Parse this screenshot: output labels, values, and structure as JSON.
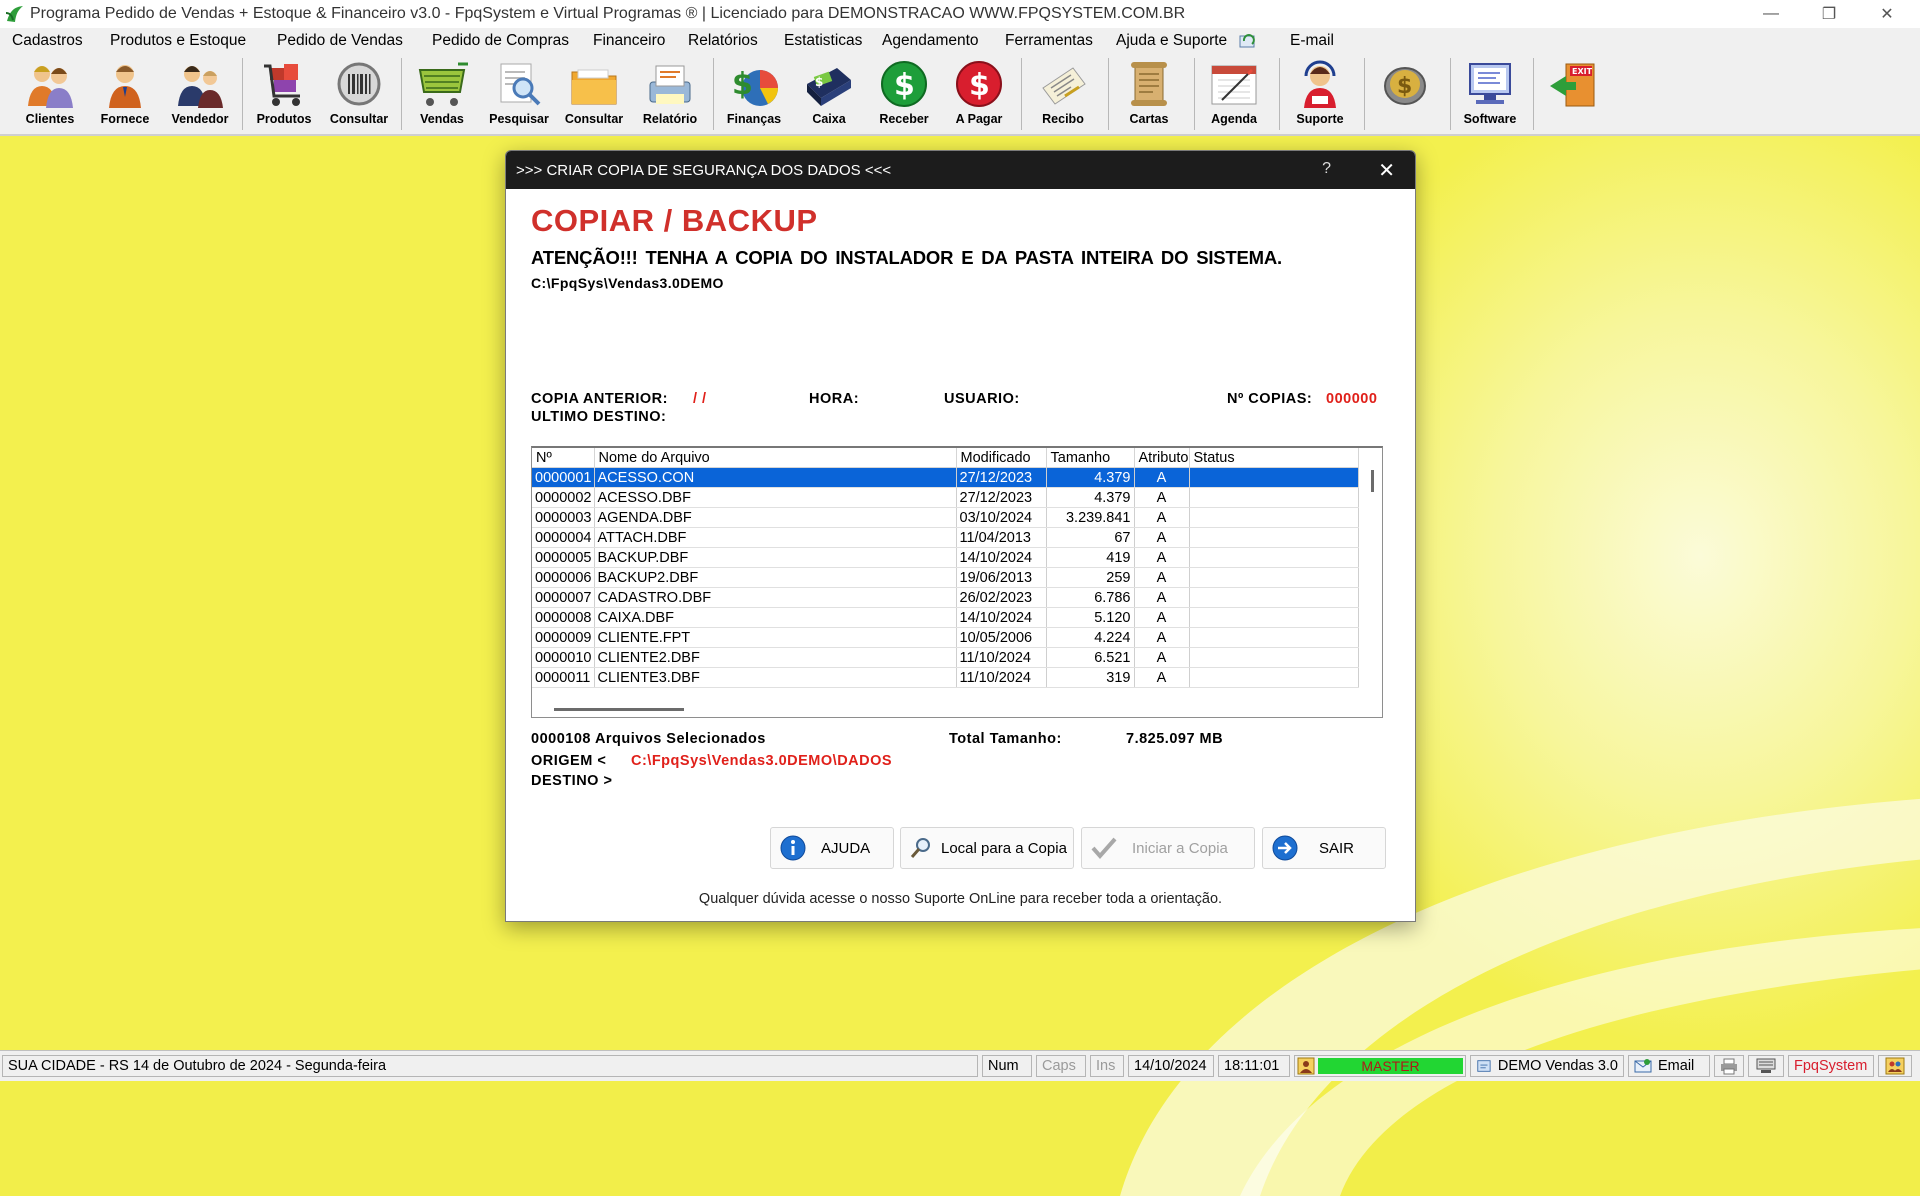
{
  "window": {
    "title": "Programa Pedido de Vendas + Estoque & Financeiro v3.0 - FpqSystem e Virtual Programas ® | Licenciado para  DEMONSTRACAO WWW.FPQSYSTEM.COM.BR",
    "minimize": "—",
    "restore": "❐",
    "close": "✕"
  },
  "menu": [
    {
      "label": "Cadastros"
    },
    {
      "label": "Produtos e Estoque"
    },
    {
      "label": "Pedido de Vendas"
    },
    {
      "label": "Pedido de Compras"
    },
    {
      "label": "Financeiro"
    },
    {
      "label": "Relatórios"
    },
    {
      "label": "Estatisticas"
    },
    {
      "label": "Agendamento"
    },
    {
      "label": "Ferramentas"
    },
    {
      "label": "Ajuda e Suporte"
    },
    {
      "label": "E-mail"
    }
  ],
  "toolbar": [
    {
      "label": "Clientes",
      "icon": "clients-icon"
    },
    {
      "label": "Fornece",
      "icon": "supplier-icon"
    },
    {
      "label": "Vendedor",
      "icon": "seller-icon"
    },
    {
      "label": "Produtos",
      "icon": "products-icon"
    },
    {
      "label": "Consultar",
      "icon": "barcode-icon"
    },
    {
      "label": "Vendas",
      "icon": "cart-icon"
    },
    {
      "label": "Pesquisar",
      "icon": "search-doc-icon"
    },
    {
      "label": "Consultar",
      "icon": "folder-icon"
    },
    {
      "label": "Relatório",
      "icon": "report-icon"
    },
    {
      "label": "Finanças",
      "icon": "finance-icon"
    },
    {
      "label": "Caixa",
      "icon": "cashbox-icon"
    },
    {
      "label": "Receber",
      "icon": "receive-icon"
    },
    {
      "label": "A Pagar",
      "icon": "pay-icon"
    },
    {
      "label": "Recibo",
      "icon": "receipt-icon"
    },
    {
      "label": "Cartas",
      "icon": "letters-icon"
    },
    {
      "label": "Agenda",
      "icon": "agenda-icon"
    },
    {
      "label": "Suporte",
      "icon": "support-icon"
    },
    {
      "label": "",
      "icon": "coin-icon"
    },
    {
      "label": "Software",
      "icon": "software-icon"
    },
    {
      "label": "",
      "icon": "exit-icon"
    }
  ],
  "dialog": {
    "title": ">>> CRIAR COPIA DE SEGURANÇA DOS DADOS <<<",
    "help": "?",
    "close": "✕",
    "heading": "COPIAR / BACKUP",
    "warning": "ATENÇÃO!!!  TENHA A COPIA DO INSTALADOR E DA PASTA INTEIRA DO SISTEMA.",
    "system_path": "C:\\FpqSys\\Vendas3.0DEMO",
    "copia_anterior_label": "COPIA ANTERIOR:",
    "copia_anterior_value": "/  /",
    "hora_label": "HORA:",
    "usuario_label": "USUARIO:",
    "n_copias_label": "Nº COPIAS:",
    "n_copias_value": "000000",
    "ultimo_destino_label": "ULTIMO DESTINO:",
    "columns": [
      "Nº",
      "Nome do Arquivo",
      "Modificado",
      "Tamanho",
      "Atributo",
      "Status"
    ],
    "rows": [
      [
        "0000001",
        "ACESSO.CON",
        "27/12/2023",
        "4.379",
        "A",
        ""
      ],
      [
        "0000002",
        "ACESSO.DBF",
        "27/12/2023",
        "4.379",
        "A",
        ""
      ],
      [
        "0000003",
        "AGENDA.DBF",
        "03/10/2024",
        "3.239.841",
        "A",
        ""
      ],
      [
        "0000004",
        "ATTACH.DBF",
        "11/04/2013",
        "67",
        "A",
        ""
      ],
      [
        "0000005",
        "BACKUP.DBF",
        "14/10/2024",
        "419",
        "A",
        ""
      ],
      [
        "0000006",
        "BACKUP2.DBF",
        "19/06/2013",
        "259",
        "A",
        ""
      ],
      [
        "0000007",
        "CADASTRO.DBF",
        "26/02/2023",
        "6.786",
        "A",
        ""
      ],
      [
        "0000008",
        "CAIXA.DBF",
        "14/10/2024",
        "5.120",
        "A",
        ""
      ],
      [
        "0000009",
        "CLIENTE.FPT",
        "10/05/2006",
        "4.224",
        "A",
        ""
      ],
      [
        "0000010",
        "CLIENTE2.DBF",
        "11/10/2024",
        "6.521",
        "A",
        ""
      ],
      [
        "0000011",
        "CLIENTE3.DBF",
        "11/10/2024",
        "319",
        "A",
        ""
      ]
    ],
    "selected_row": 0,
    "arquivos_selecionados": "0000108 Arquivos  Selecionados",
    "total_tamanho_label": "Total Tamanho:",
    "total_tamanho_value": "7.825.097 MB",
    "origem_label": "ORIGEM  <",
    "origem_value": "C:\\FpqSys\\Vendas3.0DEMO\\DADOS",
    "destino_label": "DESTINO >",
    "buttons": {
      "ajuda": "AJUDA",
      "local": "Local para a Copia",
      "iniciar": "Iniciar a Copia",
      "sair": "SAIR"
    },
    "footer": "Qualquer dúvida acesse o nosso Suporte OnLine para receber toda a orientação."
  },
  "statusbar": {
    "city_date": "SUA CIDADE - RS 14 de Outubro de 2024 - Segunda-feira",
    "num": "Num",
    "caps": "Caps",
    "ins": "Ins",
    "date": "14/10/2024",
    "time": "18:11:01",
    "user": "MASTER",
    "version": "DEMO Vendas 3.0",
    "email": "Email",
    "brand": "FpqSystem"
  },
  "colors": {
    "accent_red": "#d0302b",
    "selection_blue": "#0a64d8",
    "desktop_yellow": "#f2ee4a",
    "master_green": "#22d633"
  }
}
